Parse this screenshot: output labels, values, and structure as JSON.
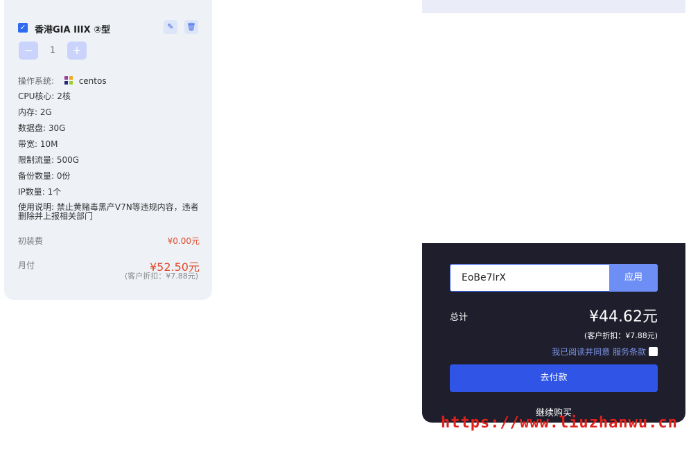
{
  "product": {
    "name": "香港GIA IIIX ②型",
    "quantity": "1",
    "minus_label": "−",
    "plus_label": "+",
    "checkbox_mark": "✓",
    "edit_icon": "✎",
    "delete_icon": "🗑"
  },
  "specs": {
    "os_label": "操作系统:",
    "os_value": "centos",
    "cpu": "CPU核心: 2核",
    "memory": "内存: 2G",
    "disk": "数据盘: 30G",
    "bandwidth": "带宽: 10M",
    "traffic": "限制流量: 500G",
    "backup": "备份数量: 0份",
    "ip": "IP数量: 1个",
    "note": "使用说明: 禁止黄赌毒黑产V7N等违规内容，违者删除并上报相关部门"
  },
  "fees": {
    "setup_label": "初装费",
    "setup_value": "¥0.00元",
    "monthly_label": "月付",
    "monthly_value": "¥52.50元",
    "monthly_discount": "(客户折扣：¥7.88元)"
  },
  "checkout": {
    "coupon_value": "EoBe7IrX",
    "apply_label": "应用",
    "total_label": "总计",
    "total_value": "¥44.62元",
    "total_discount": "(客户折扣：¥7.88元)",
    "agree_text": "我已阅读并同意 服务条款",
    "pay_label": "去付款",
    "continue_label": "继续购买"
  },
  "watermark": "https://www.liuzhanwu.cn",
  "colors": {
    "accent": "#2f54e6",
    "price": "#e04b2a",
    "dark_panel": "#1e1e2d",
    "card_bg": "#eef2f7"
  }
}
